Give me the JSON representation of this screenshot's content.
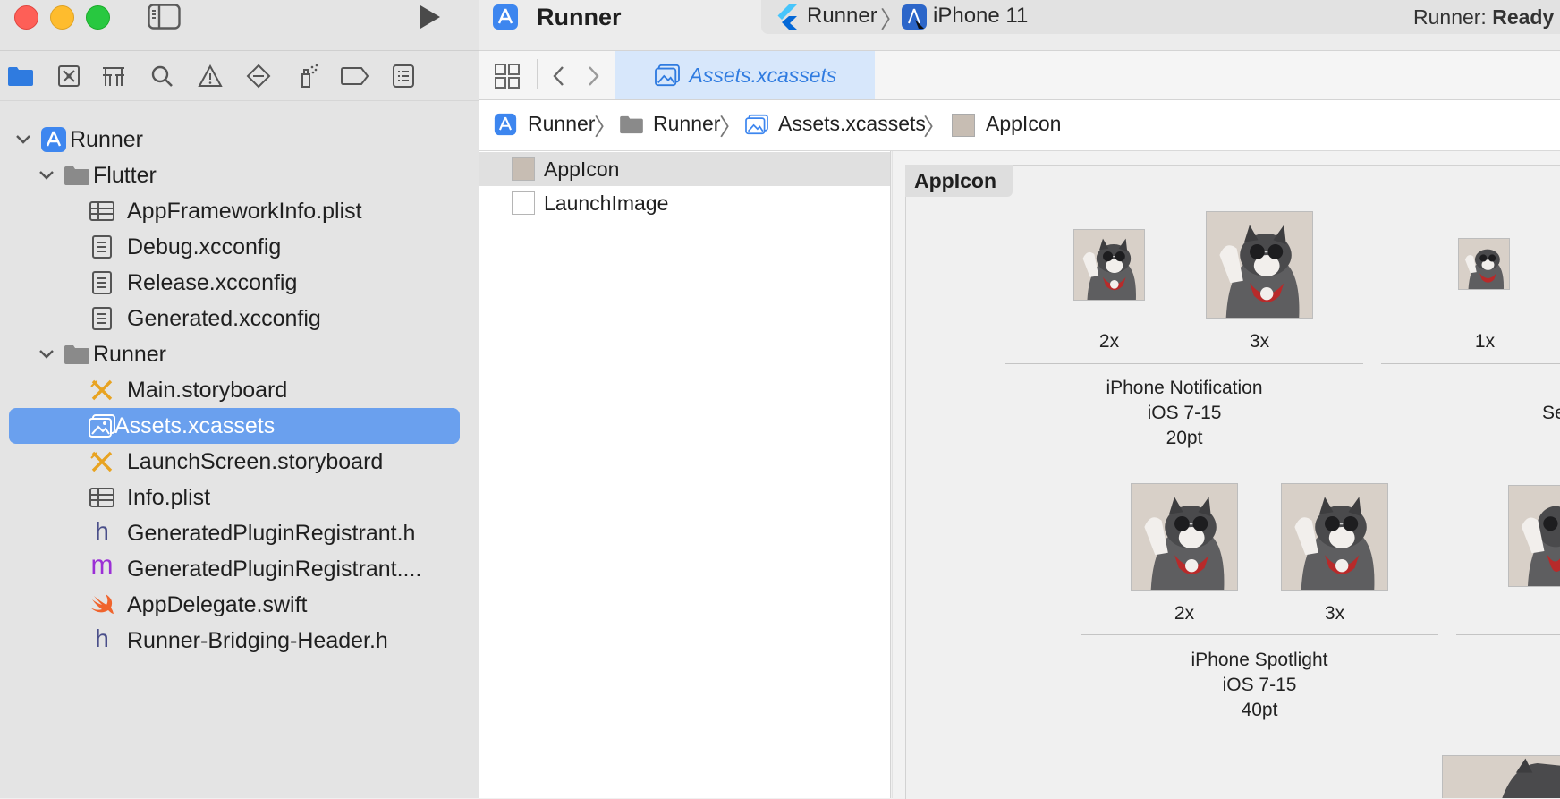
{
  "window": {
    "title": "Runner",
    "scheme_target": "Runner",
    "scheme_device": "iPhone 11",
    "status_prefix": "Runner: ",
    "status_value": "Ready"
  },
  "tab": {
    "label": "Assets.xcassets"
  },
  "breadcrumbs": [
    "Runner",
    "Runner",
    "Assets.xcassets",
    "AppIcon"
  ],
  "navigator": {
    "tabs": [
      "project-navigator",
      "source-control-navigator",
      "symbol-navigator",
      "find-navigator",
      "issue-navigator",
      "test-navigator",
      "debug-navigator",
      "breakpoint-navigator",
      "report-navigator"
    ],
    "items": [
      {
        "label": "Runner",
        "icon": "xcode-project-icon"
      },
      {
        "label": "Flutter",
        "icon": "folder-icon"
      },
      {
        "label": "AppFrameworkInfo.plist",
        "icon": "plist-table-icon"
      },
      {
        "label": "Debug.xcconfig",
        "icon": "document-icon"
      },
      {
        "label": "Release.xcconfig",
        "icon": "document-icon"
      },
      {
        "label": "Generated.xcconfig",
        "icon": "document-icon"
      },
      {
        "label": "Runner",
        "icon": "folder-icon"
      },
      {
        "label": "Main.storyboard",
        "icon": "storyboard-icon"
      },
      {
        "label": "Assets.xcassets",
        "icon": "asset-catalog-icon"
      },
      {
        "label": "LaunchScreen.storyboard",
        "icon": "storyboard-icon"
      },
      {
        "label": "Info.plist",
        "icon": "plist-table-icon"
      },
      {
        "label": "GeneratedPluginRegistrant.h",
        "icon": "header-h-icon"
      },
      {
        "label": "GeneratedPluginRegistrant....",
        "icon": "objc-m-icon"
      },
      {
        "label": "AppDelegate.swift",
        "icon": "swift-icon"
      },
      {
        "label": "Runner-Bridging-Header.h",
        "icon": "header-h-icon"
      }
    ]
  },
  "asset_list": [
    "AppIcon",
    "LaunchImage"
  ],
  "detail": {
    "heading": "AppIcon",
    "groups": [
      {
        "line1": "iPhone Notification",
        "line2": "iOS 7-15",
        "line3": "20pt",
        "slots": [
          "2x",
          "3x"
        ]
      },
      {
        "line1": "iPhone Spotlight",
        "line2": "iOS 7-15",
        "line3": "40pt",
        "slots": [
          "2x",
          "3x"
        ]
      }
    ],
    "partial_slot": "1x",
    "partial_caption": "Se"
  },
  "colors": {
    "accent": "#2f7be0",
    "selection": "#6aa0ee",
    "close": "#fe5f57",
    "minimize": "#febc2e",
    "maximize": "#28c840"
  }
}
